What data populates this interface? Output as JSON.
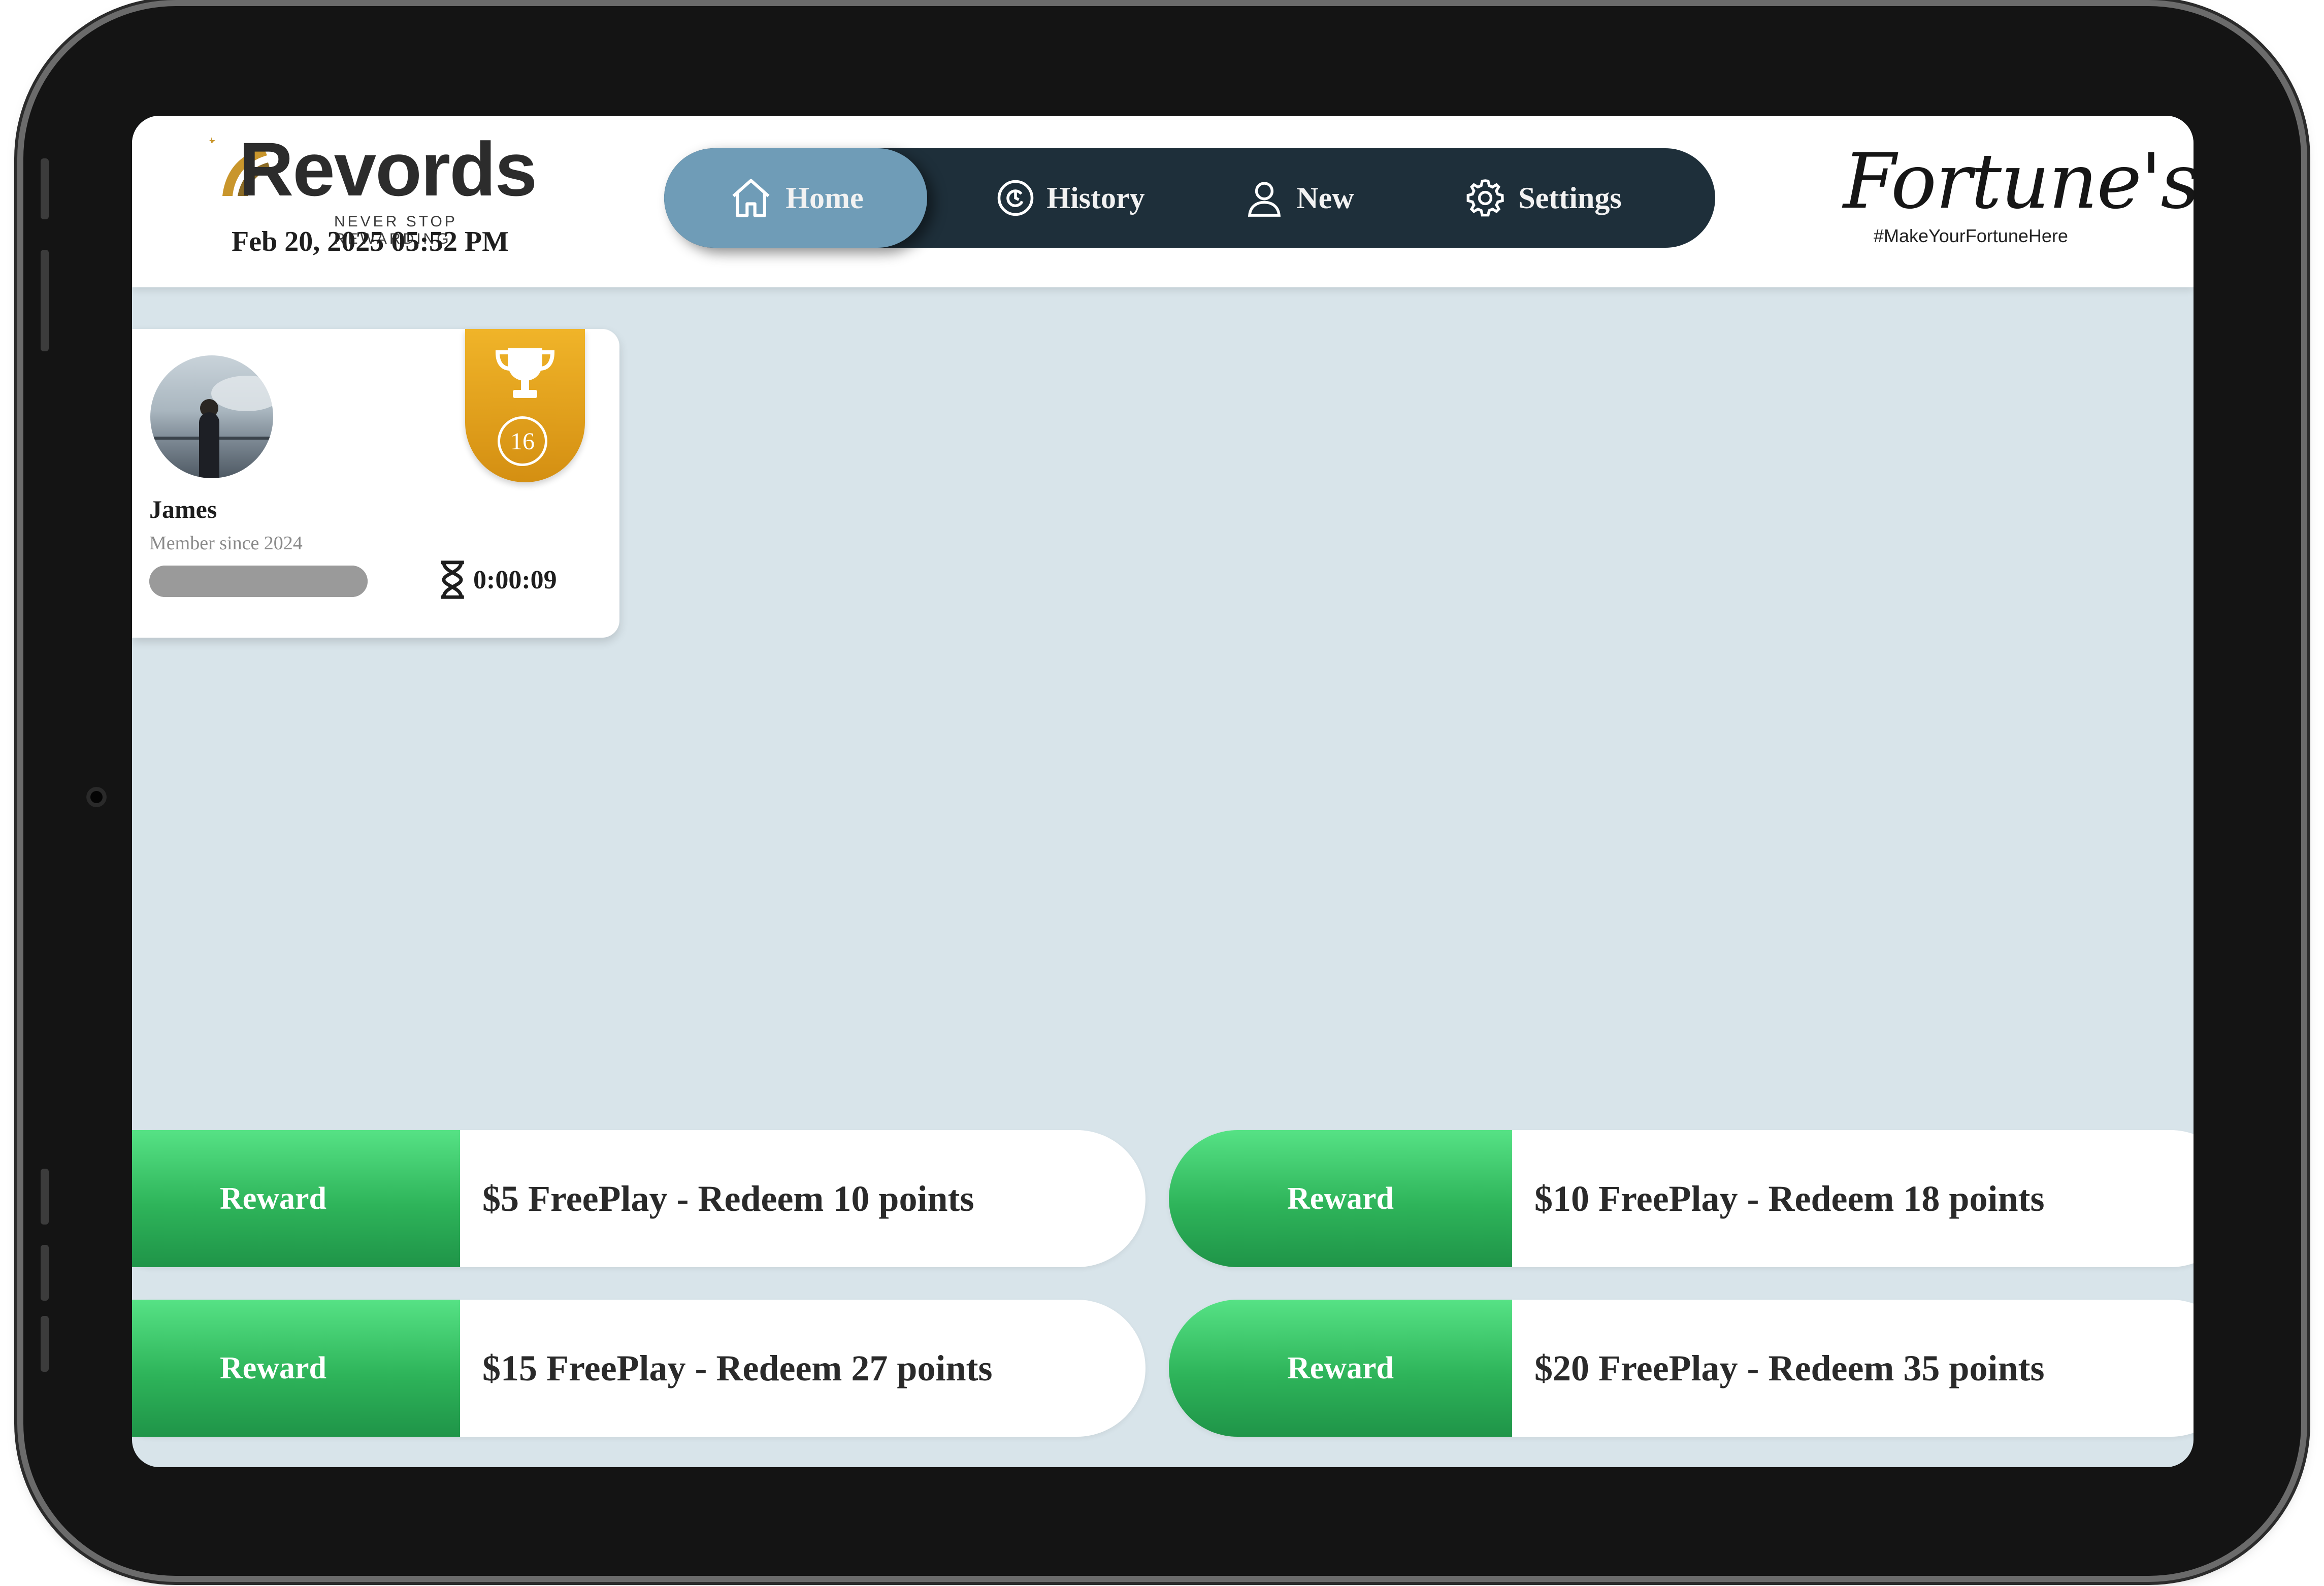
{
  "header": {
    "logo": {
      "name": "Revords",
      "tagline": "NEVER STOP REWARDING"
    },
    "datetime": "Feb 20, 2025 05:52 PM",
    "nav": [
      {
        "label": "Home",
        "icon": "home-icon",
        "active": true
      },
      {
        "label": "History",
        "icon": "history-icon",
        "active": false
      },
      {
        "label": "New",
        "icon": "user-icon",
        "active": false
      },
      {
        "label": "Settings",
        "icon": "gear-icon",
        "active": false
      }
    ],
    "brand": {
      "name": "Fortune's",
      "tagline": "#MakeYourFortuneHere"
    }
  },
  "player": {
    "name": "James",
    "member_since": "Member since 2024",
    "level": "16",
    "timer": "0:00:09",
    "progress": 1.0
  },
  "rewards": [
    {
      "button_label": "Reward",
      "text": "$5 FreePlay - Redeem 10 points"
    },
    {
      "button_label": "Reward",
      "text": "$10 FreePlay - Redeem 18 points"
    },
    {
      "button_label": "Reward",
      "text": "$15 FreePlay - Redeem 27 points"
    },
    {
      "button_label": "Reward",
      "text": "$20 FreePlay - Redeem 35 points"
    }
  ],
  "colors": {
    "nav_bg": "#1e2f3a",
    "nav_active": "#6f9cb7",
    "reward_green": "#2eb45a",
    "badge_gold": "#e3a01e",
    "screen_bg": "#d8e4ea"
  }
}
